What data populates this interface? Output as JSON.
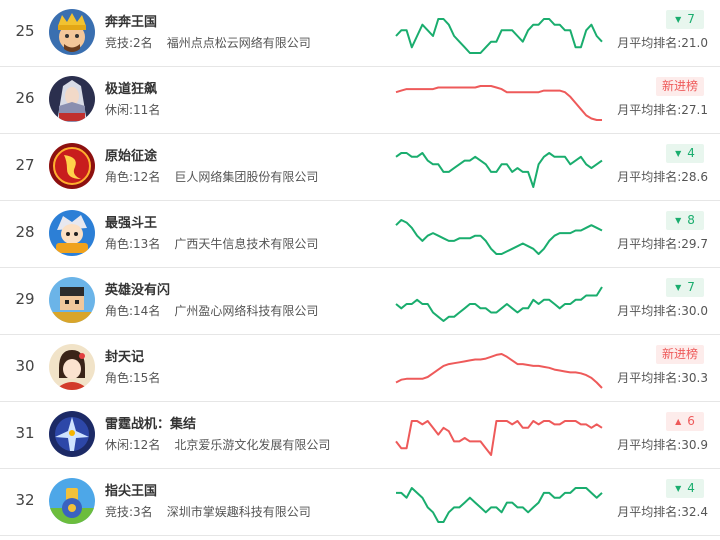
{
  "rows": [
    {
      "rank": "25",
      "name": "奔奔王国",
      "category": "竞技:2名",
      "company": "福州点点松云网络有限公司",
      "badge": {
        "type": "down",
        "text": "7"
      },
      "avg": "月平均排名:21.0",
      "icon": "king-avatar-icon",
      "spark": {
        "color": "#1aad6e",
        "values": [
          24,
          23,
          23,
          26,
          24,
          22,
          23,
          24,
          21,
          21,
          22,
          24,
          25,
          26,
          27,
          27,
          27,
          26,
          25,
          25,
          23,
          23,
          23,
          24,
          25,
          23,
          22,
          22,
          21,
          21,
          22,
          22,
          23,
          23,
          26,
          26,
          23,
          22,
          24,
          25
        ]
      }
    },
    {
      "rank": "26",
      "name": "极道狂飙",
      "category": "休闲:11名",
      "company": "",
      "badge": {
        "type": "new",
        "text": "新进榜"
      },
      "avg": "月平均排名:27.1",
      "icon": "warrior-avatar-icon",
      "spark": {
        "color": "#ee5a5a",
        "values": [
          27.5,
          27.4,
          27.3,
          27.3,
          27.3,
          27.3,
          27.3,
          27.3,
          27.2,
          27.2,
          27.2,
          27.2,
          27.2,
          27.2,
          27.2,
          27.2,
          27.1,
          27.1,
          27.1,
          27.2,
          27.3,
          27.5,
          27.5,
          27.5,
          27.5,
          27.5,
          27.5,
          27.5,
          27.4,
          27.4,
          27.4,
          27.4,
          27.5,
          27.8,
          28.2,
          28.6,
          29.0,
          29.2,
          29.3,
          29.3
        ]
      }
    },
    {
      "rank": "27",
      "name": "原始征途",
      "category": "角色:12名",
      "company": "巨人网络集团股份有限公司",
      "badge": {
        "type": "down",
        "text": "4"
      },
      "avg": "月平均排名:28.6",
      "icon": "red-emblem-icon",
      "spark": {
        "color": "#1aad6e",
        "values": [
          28,
          27.5,
          27.5,
          28,
          28,
          27.5,
          28.5,
          29,
          29,
          30,
          30,
          29.5,
          29,
          28.5,
          28.5,
          28,
          28.5,
          29,
          30,
          30,
          29,
          29,
          30,
          29.5,
          30,
          30,
          32,
          29,
          28,
          27.5,
          28,
          28,
          28,
          29,
          28.5,
          28,
          29,
          29.5,
          29,
          28.5
        ]
      }
    },
    {
      "rank": "28",
      "name": "最强斗王",
      "category": "角色:13名",
      "company": "广西天牛信息技术有限公司",
      "badge": {
        "type": "down",
        "text": "8"
      },
      "avg": "月平均排名:29.7",
      "icon": "fighter-avatar-icon",
      "spark": {
        "color": "#1aad6e",
        "values": [
          27,
          26,
          26.5,
          27.5,
          29,
          30,
          29,
          28.5,
          29,
          29.5,
          30,
          30,
          29.5,
          29.5,
          29.5,
          29,
          29,
          30,
          31.5,
          32.5,
          32.5,
          32,
          31.5,
          31,
          30.5,
          31,
          31.5,
          32.5,
          31.5,
          30,
          29,
          28.5,
          28.5,
          28.5,
          28,
          28,
          27.5,
          27,
          27.5,
          28
        ]
      }
    },
    {
      "rank": "29",
      "name": "英雄没有闪",
      "category": "角色:14名",
      "company": "广州盈心网络科技有限公司",
      "badge": {
        "type": "down",
        "text": "7"
      },
      "avg": "月平均排名:30.0",
      "icon": "pixel-hero-icon",
      "spark": {
        "color": "#1aad6e",
        "values": [
          31,
          31.5,
          31,
          31,
          30.5,
          31,
          31,
          32,
          32.5,
          33,
          32.5,
          32.5,
          32,
          31.5,
          31,
          31,
          31.5,
          31.5,
          32,
          32,
          31.5,
          31,
          31.5,
          32,
          31.5,
          31.5,
          30.5,
          31,
          30.5,
          30.5,
          31,
          31.5,
          31,
          31,
          30.5,
          30.5,
          30,
          30,
          30,
          29
        ]
      }
    },
    {
      "rank": "30",
      "name": "封天记",
      "category": "角色:15名",
      "company": "",
      "badge": {
        "type": "new",
        "text": "新进榜"
      },
      "avg": "月平均排名:30.3",
      "icon": "heroine-avatar-icon",
      "spark": {
        "color": "#ee5a5a",
        "values": [
          30.4,
          30.1,
          30.0,
          30.0,
          30.0,
          30.0,
          29.8,
          29.4,
          29.0,
          28.6,
          28.4,
          28.3,
          28.2,
          28.1,
          28.0,
          27.9,
          27.9,
          27.8,
          27.6,
          27.4,
          27.3,
          27.6,
          28.0,
          28.4,
          28.4,
          28.5,
          28.6,
          28.6,
          28.7,
          28.8,
          29.0,
          29.1,
          29.2,
          29.3,
          29.3,
          29.4,
          29.6,
          29.9,
          30.4,
          31.0
        ]
      }
    },
    {
      "rank": "31",
      "name": "雷霆战机：集结",
      "category": "休闲:12名",
      "company": "北京爱乐游文化发展有限公司",
      "badge": {
        "type": "up",
        "text": "6"
      },
      "avg": "月平均排名:30.9",
      "icon": "jet-fighter-icon",
      "spark": {
        "color": "#ee5a5a",
        "values": [
          33,
          34,
          34,
          30,
          30,
          30.5,
          30,
          31,
          32,
          31,
          31.5,
          33,
          33,
          32.5,
          33,
          33,
          33,
          34,
          35,
          30,
          30,
          30,
          30.5,
          30,
          31,
          31,
          30,
          30.5,
          30,
          30,
          30.5,
          30.5,
          30,
          30,
          30,
          30.5,
          30.5,
          31,
          30.5,
          31
        ]
      }
    },
    {
      "rank": "32",
      "name": "指尖王国",
      "category": "竞技:3名",
      "company": "深圳市掌娱趣科技有限公司",
      "badge": {
        "type": "down",
        "text": "4"
      },
      "avg": "月平均排名:32.4",
      "icon": "cannon-kingdom-icon",
      "spark": {
        "color": "#1aad6e",
        "values": [
          31,
          31,
          31.5,
          30.5,
          31,
          31.5,
          32.5,
          33,
          34,
          34,
          33,
          32.5,
          32.5,
          32,
          31.5,
          32,
          32.5,
          33,
          32.5,
          32.5,
          33,
          32,
          32,
          32.5,
          32.5,
          33,
          32.5,
          32,
          31,
          31,
          31.5,
          31.5,
          31,
          31,
          30.5,
          30.5,
          30.5,
          31,
          31.5,
          31
        ]
      }
    }
  ]
}
